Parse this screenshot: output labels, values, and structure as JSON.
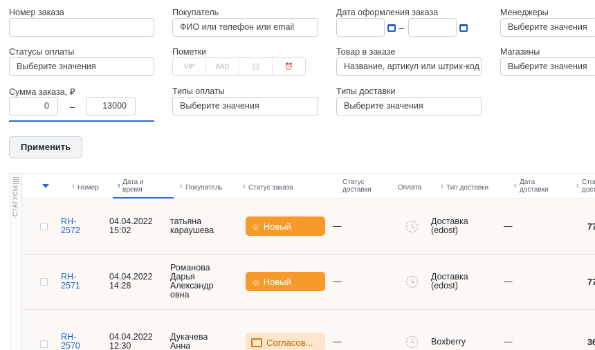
{
  "filters": {
    "order_number": {
      "label": "Номер заказа",
      "value": ""
    },
    "buyer": {
      "label": "Покупатель",
      "placeholder": "ФИО или телефон или email"
    },
    "order_date": {
      "label": "Дата оформления заказа",
      "separator": "–"
    },
    "managers": {
      "label": "Менеджеры",
      "placeholder": "Выберите значения"
    },
    "payment_statuses": {
      "label": "Статусы оплаты",
      "placeholder": "Выберите значения"
    },
    "marks": {
      "label": "Пометки",
      "tags": [
        "VIP",
        "BAD",
        "⟦⟧",
        "⏰"
      ]
    },
    "product": {
      "label": "Товар в заказе",
      "placeholder": "Название, артикул или штрих-код"
    },
    "stores": {
      "label": "Магазины",
      "placeholder": "Выберите значения"
    },
    "amount": {
      "label": "Сумма заказа, ₽",
      "min": "0",
      "max": "13000",
      "separator": "–"
    },
    "payment_types": {
      "label": "Типы оплаты",
      "placeholder": "Выберите значения"
    },
    "delivery_types": {
      "label": "Типы доставки",
      "placeholder": "Выберите значения"
    }
  },
  "apply_label": "Применить",
  "sidebar_label": "СТАТУСЫ",
  "columns": {
    "number": "Номер",
    "datetime": "Дата и\nвремя",
    "buyer": "Покупатель",
    "status": "Статус заказа",
    "delivery_status": "Статус\nдоставки",
    "payment": "Оплата",
    "delivery_type": "Тип доставки",
    "delivery_date": "Дата\nдоставки",
    "cost": "Стоимо\nдоста"
  },
  "orders": [
    {
      "number": "RH-\n2572",
      "datetime": "04.04.2022\n15:02",
      "buyer": "татьяна\nкараушева",
      "status": "Новый",
      "delivery_status": "—",
      "delivery_type": "Доставка\n(edost)",
      "delivery_date": "—",
      "amount": "77"
    },
    {
      "number": "RH-\n2571",
      "datetime": "04.04.2022\n14:28",
      "buyer": "Романова\nДарья\nАлександр\nовна",
      "status": "Новый",
      "delivery_status": "—",
      "delivery_type": "Доставка\n(edost)",
      "delivery_date": "—",
      "amount": "77"
    },
    {
      "number": "RH-\n2570",
      "datetime": "04.04.2022\n12:30",
      "buyer": "Дукачева\nАнна",
      "status": "Согласов...",
      "delivery_status": "—",
      "delivery_type": "Boxberry",
      "delivery_date": "—",
      "amount": "36"
    }
  ],
  "colors": {
    "accent": "#2a6bd1",
    "link": "#1f63c7",
    "status_new": "#f79a2a",
    "status_pending_bg": "#fde6cc"
  }
}
